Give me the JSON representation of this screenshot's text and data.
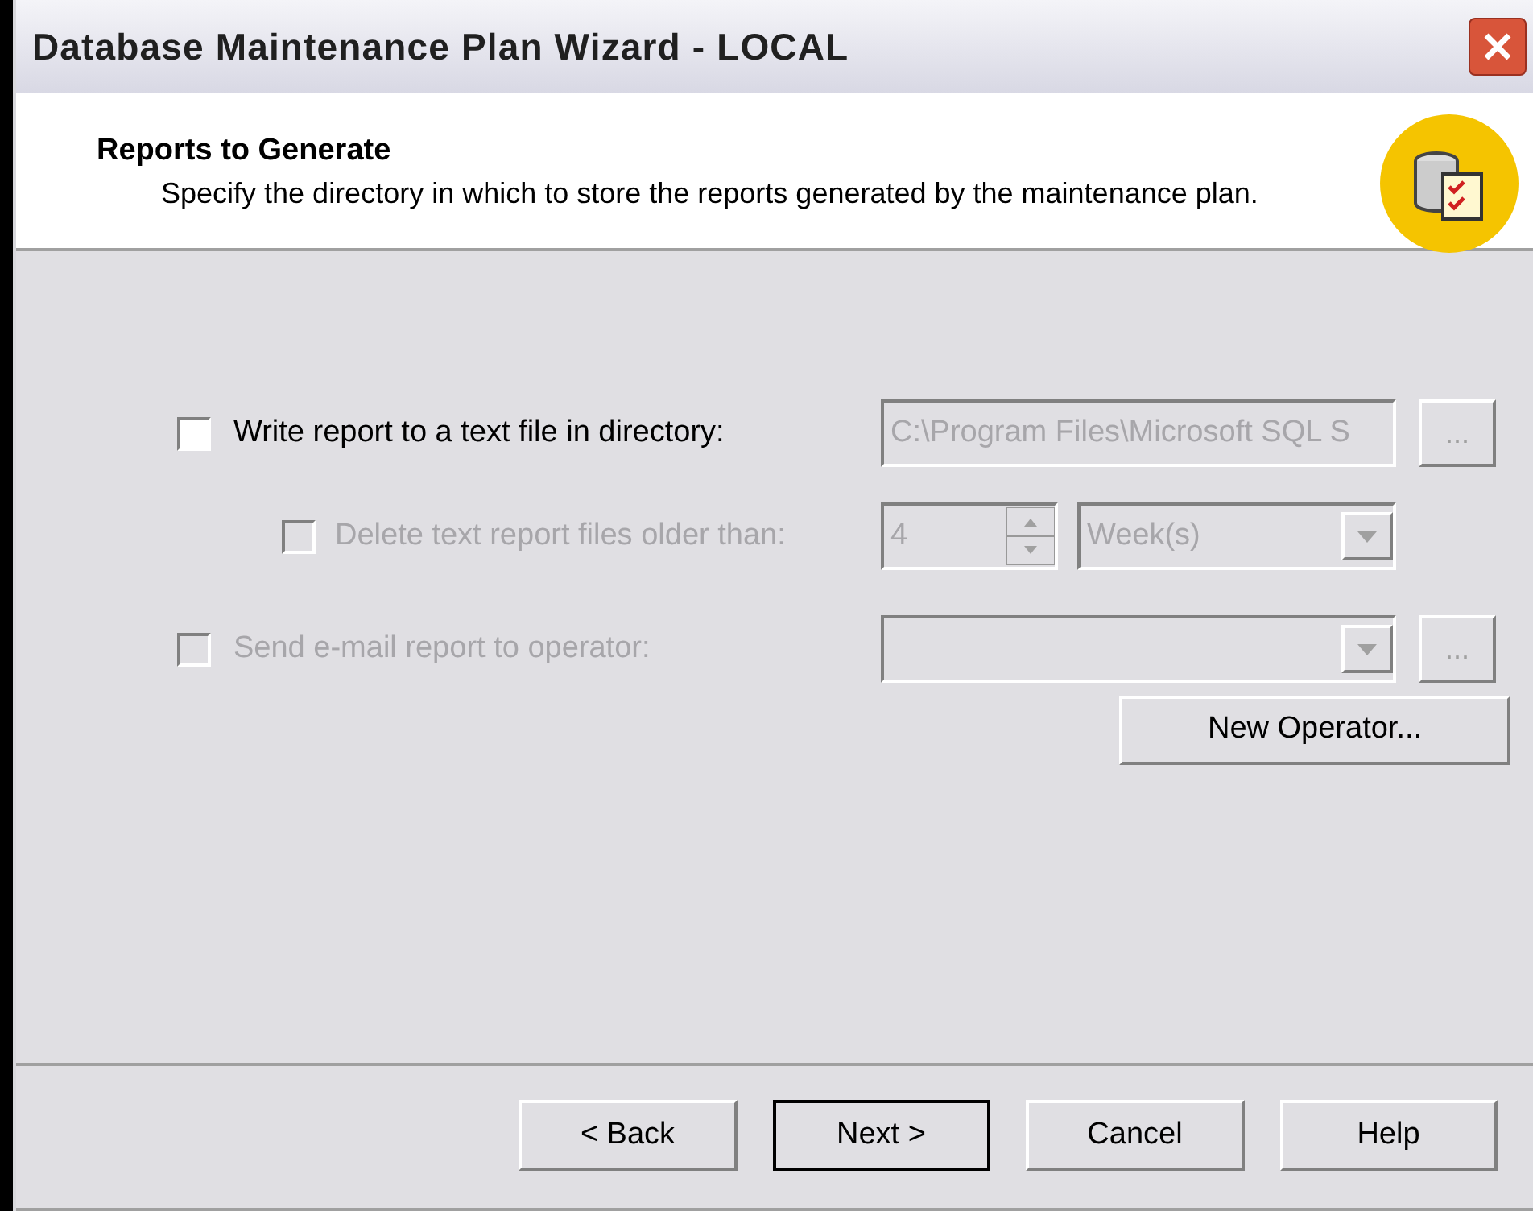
{
  "window": {
    "title": "Database Maintenance Plan Wizard - LOCAL"
  },
  "header": {
    "title": "Reports to Generate",
    "description": "Specify the directory in which to store the reports generated by the maintenance plan."
  },
  "report_file": {
    "label": "Write report to a text file in directory:",
    "checked": false,
    "disabled": false,
    "path": {
      "value": "C:\\Program Files\\Microsoft SQL S",
      "disabled": true
    },
    "browse": {
      "label": "...",
      "disabled": true
    }
  },
  "delete_old": {
    "label": "Delete text report files older than:",
    "checked": false,
    "disabled": true,
    "count": {
      "value": "4",
      "disabled": true
    },
    "unit": {
      "value": "Week(s)",
      "disabled": true
    }
  },
  "email": {
    "label": "Send e-mail report to operator:",
    "checked": false,
    "disabled": true,
    "operator": {
      "disabled": true
    },
    "browse": {
      "label": "...",
      "disabled": true
    }
  },
  "new_operator": {
    "label": "New Operator...",
    "disabled": false
  },
  "buttons": [
    {
      "label": "< Back",
      "default": false
    },
    {
      "label": "Next >",
      "default": true
    },
    {
      "label": "Cancel",
      "default": false
    },
    {
      "label": "Help",
      "default": false
    }
  ]
}
